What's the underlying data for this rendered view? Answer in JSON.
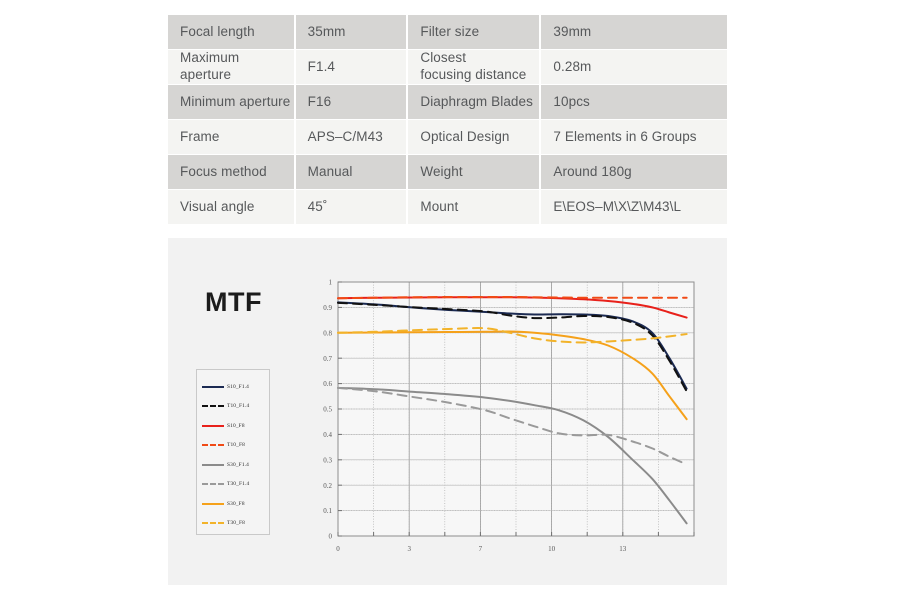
{
  "spec_table": {
    "rows": [
      {
        "shade": "dark",
        "label": "Focal length",
        "value": "35mm",
        "label2": "Filter size",
        "value2": "39mm",
        "label2_twoline": false
      },
      {
        "shade": "light",
        "label": "Maximum aperture",
        "value": "F1.4",
        "label2": "Closest\nfocusing distance",
        "value2": "0.28m",
        "label2_twoline": true
      },
      {
        "shade": "dark",
        "label": "Minimum aperture",
        "value": "F16",
        "label2": "Diaphragm Blades",
        "value2": "10pcs",
        "label2_twoline": false
      },
      {
        "shade": "light",
        "label": "Frame",
        "value": "APS–C/M43",
        "label2": "Optical Design",
        "value2": "7 Elements in 6 Groups",
        "label2_twoline": false
      },
      {
        "shade": "dark",
        "label": "Focus method",
        "value": "Manual",
        "label2": "Weight",
        "value2": "Around 180g",
        "label2_twoline": false
      },
      {
        "shade": "light",
        "label": "Visual angle",
        "value": "45˚",
        "label2": "Mount",
        "value2": "E\\EOS–M\\X\\Z\\M43\\L",
        "label2_twoline": false
      }
    ]
  },
  "mtf": {
    "title": "MTF"
  },
  "chart_data": {
    "type": "line",
    "title": "MTF",
    "xlabel": "",
    "ylabel": "",
    "xlim": [
      0,
      14.5
    ],
    "ylim": [
      0,
      1
    ],
    "grid": true,
    "legend_position": "left-outside",
    "x_ticks_labeled": [
      0,
      3,
      7,
      10,
      13
    ],
    "x_tick_step": 1.45,
    "y_ticks": [
      0,
      0.1,
      0.2,
      0.3,
      0.4,
      0.5,
      0.6,
      0.7,
      0.8,
      0.9,
      1
    ],
    "series": [
      {
        "name": "S10_F1.4",
        "color": "#1b2a52",
        "style": "solid",
        "x": [
          0,
          1.5,
          3,
          4.5,
          6,
          7,
          8,
          9,
          10,
          11,
          12,
          12.8,
          13.5,
          14.2
        ],
        "y": [
          0.92,
          0.912,
          0.9,
          0.89,
          0.882,
          0.876,
          0.872,
          0.873,
          0.872,
          0.866,
          0.845,
          0.8,
          0.7,
          0.58
        ]
      },
      {
        "name": "T10_F1.4",
        "color": "#111111",
        "style": "dashed",
        "x": [
          0,
          1.5,
          3,
          4.5,
          6,
          7,
          8,
          9,
          10,
          11,
          12,
          12.8,
          13.5,
          14.2
        ],
        "y": [
          0.918,
          0.91,
          0.901,
          0.893,
          0.884,
          0.868,
          0.858,
          0.86,
          0.866,
          0.862,
          0.84,
          0.79,
          0.69,
          0.57
        ]
      },
      {
        "name": "S10_F8",
        "color": "#e8211b",
        "style": "solid",
        "x": [
          0,
          1.5,
          3,
          4.5,
          6,
          7,
          8,
          9,
          10,
          11,
          12,
          12.8,
          13.5,
          14.2
        ],
        "y": [
          0.936,
          0.938,
          0.939,
          0.94,
          0.94,
          0.94,
          0.939,
          0.936,
          0.932,
          0.925,
          0.914,
          0.9,
          0.88,
          0.86
        ]
      },
      {
        "name": "T10_F8",
        "color": "#f04a16",
        "style": "dashed",
        "x": [
          0,
          1.5,
          3,
          4.5,
          6,
          7,
          8,
          9,
          10,
          11,
          12,
          12.8,
          13.5,
          14.2
        ],
        "y": [
          0.936,
          0.938,
          0.94,
          0.941,
          0.941,
          0.941,
          0.94,
          0.939,
          0.938,
          0.938,
          0.938,
          0.938,
          0.938,
          0.938
        ]
      },
      {
        "name": "S30_F1.4",
        "color": "#8b8b8b",
        "style": "solid",
        "x": [
          0,
          1.5,
          3,
          4.5,
          6,
          7,
          8,
          9,
          10,
          11,
          12,
          12.8,
          13.5,
          14.2
        ],
        "y": [
          0.583,
          0.578,
          0.568,
          0.558,
          0.545,
          0.532,
          0.515,
          0.495,
          0.455,
          0.39,
          0.3,
          0.225,
          0.14,
          0.05
        ]
      },
      {
        "name": "T30_F1.4",
        "color": "#9a9a9a",
        "style": "dashed",
        "x": [
          0,
          1.5,
          3,
          4.5,
          6,
          7,
          8,
          9,
          10,
          11,
          12,
          12.8,
          13.5,
          14.2
        ],
        "y": [
          0.583,
          0.57,
          0.548,
          0.525,
          0.495,
          0.463,
          0.432,
          0.404,
          0.396,
          0.398,
          0.372,
          0.345,
          0.312,
          0.282
        ]
      },
      {
        "name": "S30_F8",
        "color": "#f5a11a",
        "style": "solid",
        "x": [
          0,
          1.5,
          3,
          4.5,
          6,
          7,
          8,
          9,
          10,
          11,
          12,
          12.8,
          13.5,
          14.2
        ],
        "y": [
          0.8,
          0.801,
          0.802,
          0.803,
          0.804,
          0.805,
          0.8,
          0.79,
          0.775,
          0.75,
          0.7,
          0.64,
          0.55,
          0.46
        ]
      },
      {
        "name": "T30_F8",
        "color": "#f2b32a",
        "style": "dashed",
        "x": [
          0,
          1.5,
          3,
          4.5,
          6,
          7,
          8,
          9,
          10,
          11,
          12,
          12.8,
          13.5,
          14.2
        ],
        "y": [
          0.8,
          0.804,
          0.81,
          0.815,
          0.818,
          0.8,
          0.778,
          0.766,
          0.762,
          0.766,
          0.772,
          0.778,
          0.786,
          0.795
        ]
      }
    ]
  }
}
